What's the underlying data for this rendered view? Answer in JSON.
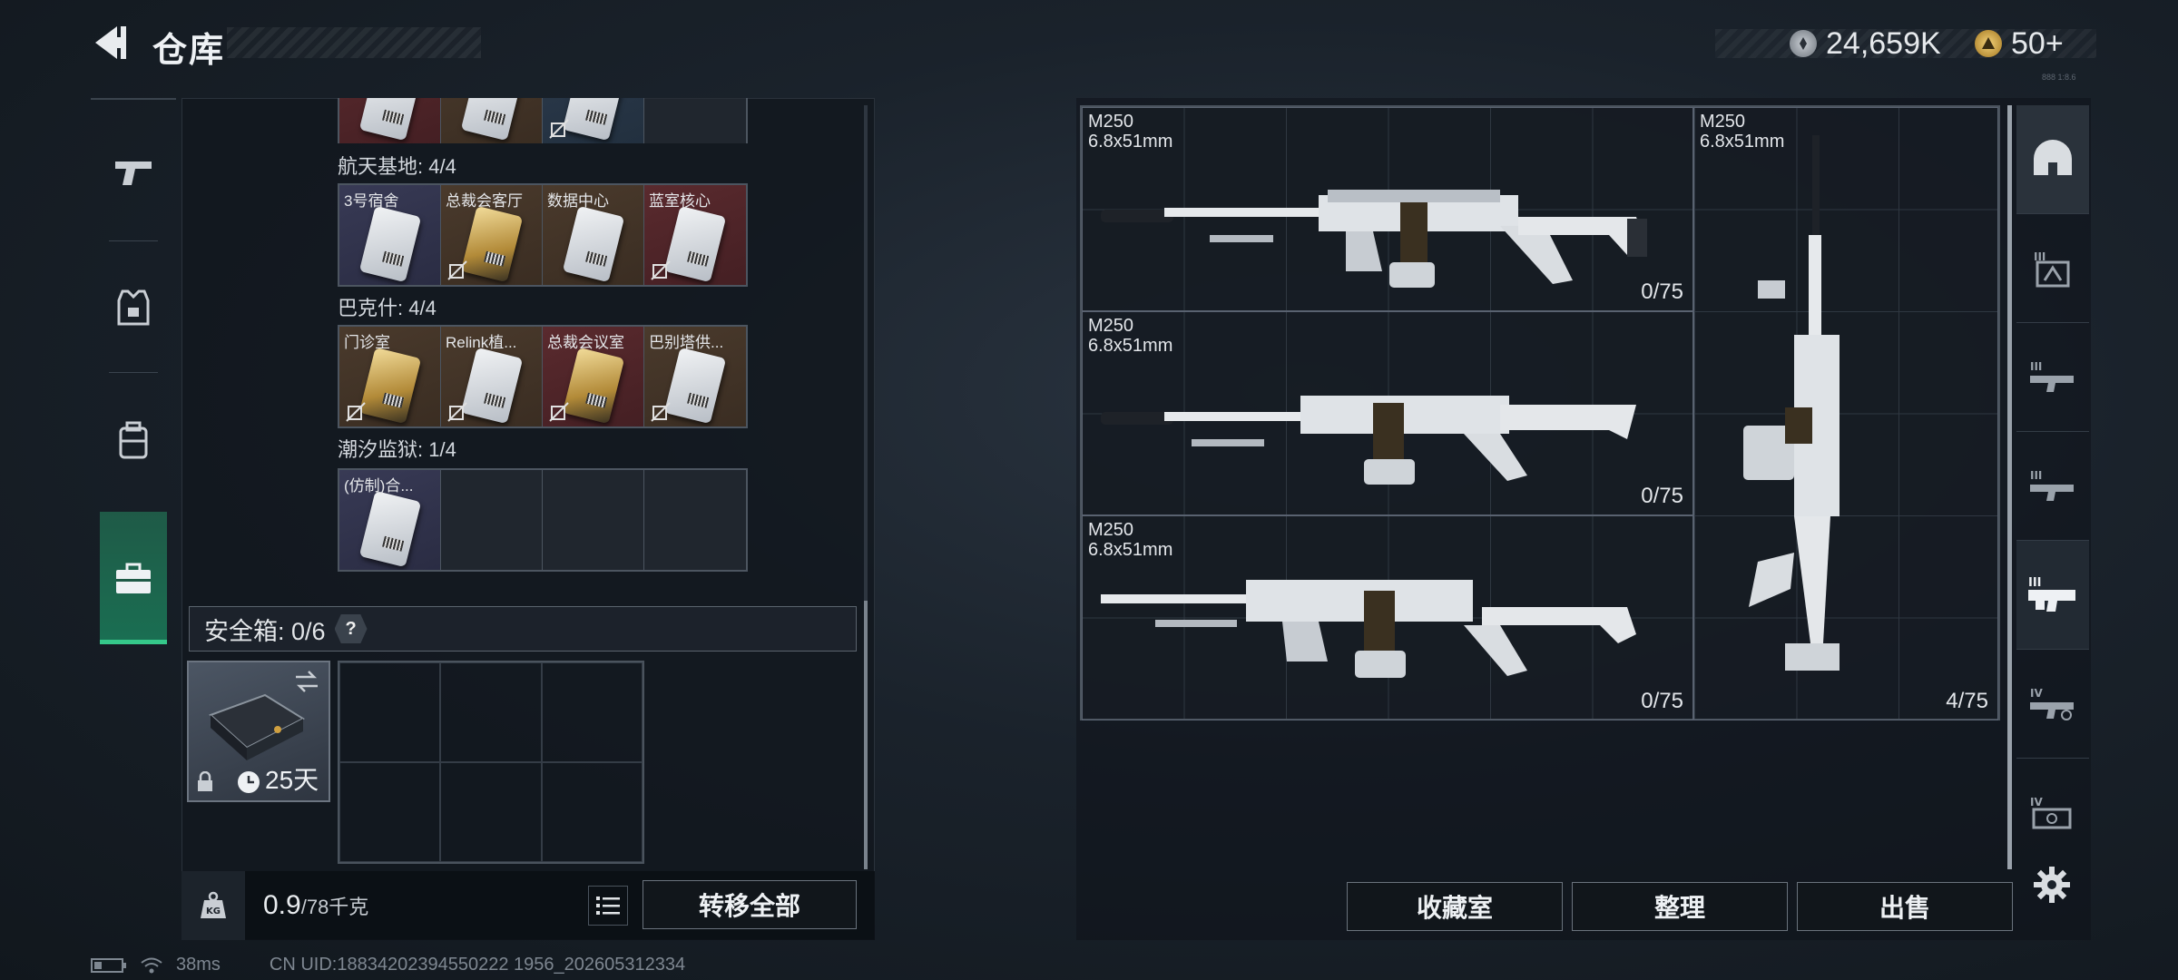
{
  "header": {
    "title": "仓库",
    "currency_primary": "24,659K",
    "currency_secondary": "50+",
    "tiny_tag": "888 1:8.6"
  },
  "left_nav": {
    "items": [
      "weapons-icon",
      "armor-icon",
      "backpack-icon",
      "case-icon"
    ],
    "active": "case-icon"
  },
  "inventory": {
    "sections": [
      {
        "label": "",
        "cards": [
          {
            "name": "",
            "color": "red"
          },
          {
            "name": "",
            "color": "brown"
          },
          {
            "name": "",
            "color": "blue"
          },
          {
            "name": "",
            "color": "empty"
          }
        ]
      },
      {
        "label": "航天基地: 4/4",
        "cards": [
          {
            "name": "3号宿舍",
            "color": "purple"
          },
          {
            "name": "总裁会客厅",
            "color": "brown"
          },
          {
            "name": "数据中心",
            "color": "brown"
          },
          {
            "name": "蓝室核心",
            "color": "red"
          }
        ]
      },
      {
        "label": "巴克什: 4/4",
        "cards": [
          {
            "name": "门诊室",
            "color": "brown"
          },
          {
            "name": "Relink植...",
            "color": "brown"
          },
          {
            "name": "总裁会议室",
            "color": "red"
          },
          {
            "name": "巴别塔供...",
            "color": "brown"
          }
        ]
      },
      {
        "label": "潮汐监狱: 1/4",
        "cards": [
          {
            "name": "(仿制)合...",
            "color": "purple"
          },
          {
            "name": "",
            "color": "empty"
          },
          {
            "name": "",
            "color": "empty"
          },
          {
            "name": "",
            "color": "empty"
          }
        ]
      }
    ]
  },
  "safe_box": {
    "title": "安全箱: 0/6",
    "help": "?",
    "timer": "25天"
  },
  "bottom_bar": {
    "weight_current": "0.9",
    "weight_max": "/78千克",
    "transfer_label": "转移全部"
  },
  "status": {
    "ping": "38ms",
    "uid": "CN UID:18834202394550222 1956_202605312334"
  },
  "weapons": [
    {
      "name": "M250",
      "caliber": "6.8x51mm",
      "ammo": "0/75"
    },
    {
      "name": "M250",
      "caliber": "6.8x51mm",
      "ammo": "0/75"
    },
    {
      "name": "M250",
      "caliber": "6.8x51mm",
      "ammo": "0/75"
    },
    {
      "name": "M250",
      "caliber": "6.8x51mm",
      "ammo": "4/75"
    }
  ],
  "actions": {
    "collection": "收藏室",
    "sort": "整理",
    "sell": "出售"
  },
  "right_nav": {
    "labels": [
      "",
      "III",
      "III",
      "III",
      "III",
      "IV",
      "IV"
    ]
  },
  "colors": {
    "accent_green": "#35c88a",
    "panel_bg": "#12181f"
  }
}
